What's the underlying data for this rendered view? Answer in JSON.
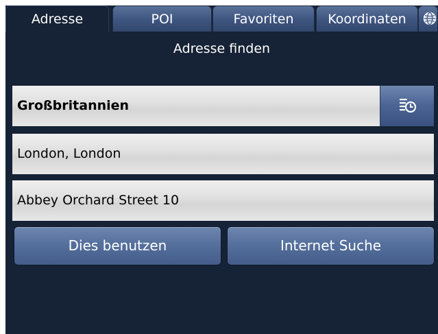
{
  "tabs": [
    {
      "label": "Adresse",
      "active": true
    },
    {
      "label": "POI",
      "active": false
    },
    {
      "label": "Favoriten",
      "active": false
    },
    {
      "label": "Koordinaten",
      "active": false
    }
  ],
  "globe_tab": {
    "icon": "globe-icon"
  },
  "title": "Adresse finden",
  "fields": {
    "country": "Großbritannien",
    "city": "London, London",
    "street": "Abbey Orchard Street 10"
  },
  "history_button": {
    "icon": "history-list-icon"
  },
  "buttons": {
    "use": "Dies benutzen",
    "internet_search": "Internet Suche"
  },
  "colors": {
    "background": "#162235",
    "tab": "#4a6088",
    "button": "#56709d",
    "field": "#e0e0e0"
  }
}
